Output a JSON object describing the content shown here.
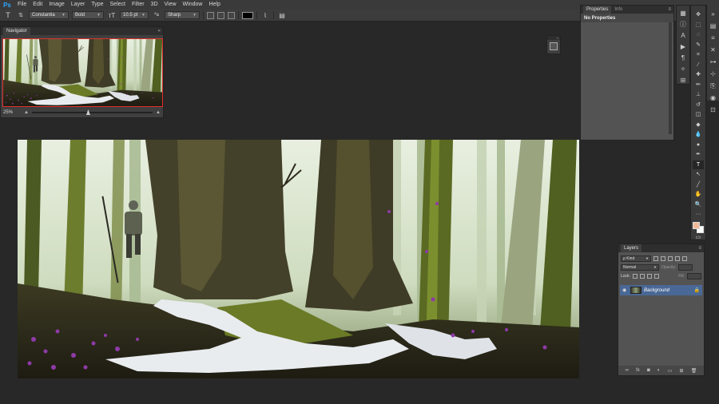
{
  "app": {
    "logo": "Ps"
  },
  "menu": [
    "File",
    "Edit",
    "Image",
    "Layer",
    "Type",
    "Select",
    "Filter",
    "3D",
    "View",
    "Window",
    "Help"
  ],
  "options_bar": {
    "tool_icon": "type-tool-icon",
    "orient_icon": "text-orientation-icon",
    "font_family": "Constantia",
    "font_style": "Bold",
    "size_icon": "font-size-icon",
    "font_size": "10.5 pt",
    "aa_icon": "anti-alias-icon",
    "aa_glyph": "ªa",
    "anti_alias": "Sharp",
    "text_color": "#000000"
  },
  "navigator": {
    "tab": "Navigator",
    "zoom": "25%",
    "viewbox_color": "#e03030"
  },
  "properties": {
    "tabs": [
      "Properties",
      "Info"
    ],
    "body": "No Properties"
  },
  "layers": {
    "tab": "Layers",
    "kind_label": "ρ Kind",
    "blend_mode": "Normal",
    "opacity_label": "Opacity:",
    "lock_label": "Lock:",
    "fill_label": "Fill:",
    "items": [
      {
        "name": "Background",
        "visible": true,
        "locked": true,
        "selected": true
      }
    ]
  },
  "colors": {
    "foreground": "#f0b89a",
    "background": "#ffffff",
    "accent": "#31a8ff",
    "selected_layer": "#4a6896"
  }
}
